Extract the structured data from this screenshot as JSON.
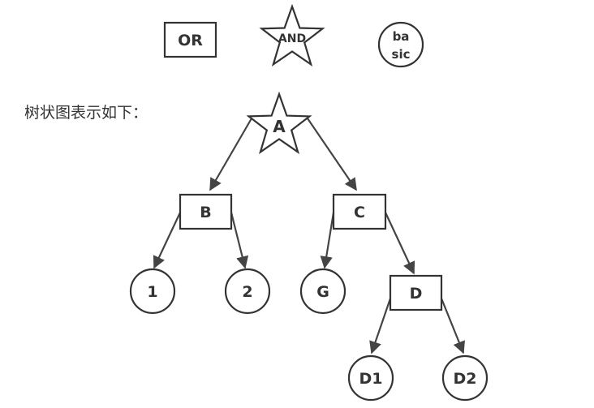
{
  "legend": {
    "or_label": "OR",
    "and_label": "AND",
    "basic_label_line1": "ba",
    "basic_label_line2": "sic"
  },
  "caption": "树状图表示如下：",
  "tree": {
    "nodes": [
      {
        "id": "A",
        "label": "A",
        "shape": "star"
      },
      {
        "id": "B",
        "label": "B",
        "shape": "rect"
      },
      {
        "id": "C",
        "label": "C",
        "shape": "rect"
      },
      {
        "id": "N1",
        "label": "1",
        "shape": "circle"
      },
      {
        "id": "N2",
        "label": "2",
        "shape": "circle"
      },
      {
        "id": "G",
        "label": "G",
        "shape": "circle"
      },
      {
        "id": "D",
        "label": "D",
        "shape": "rect"
      },
      {
        "id": "D1",
        "label": "D1",
        "shape": "circle"
      },
      {
        "id": "D2",
        "label": "D2",
        "shape": "circle"
      }
    ],
    "edges": [
      [
        "A",
        "B"
      ],
      [
        "A",
        "C"
      ],
      [
        "B",
        "N1"
      ],
      [
        "B",
        "N2"
      ],
      [
        "C",
        "G"
      ],
      [
        "C",
        "D"
      ],
      [
        "D",
        "D1"
      ],
      [
        "D",
        "D2"
      ]
    ]
  },
  "colors": {
    "stroke": "#333333",
    "text": "#333333",
    "background": "#ffffff"
  }
}
